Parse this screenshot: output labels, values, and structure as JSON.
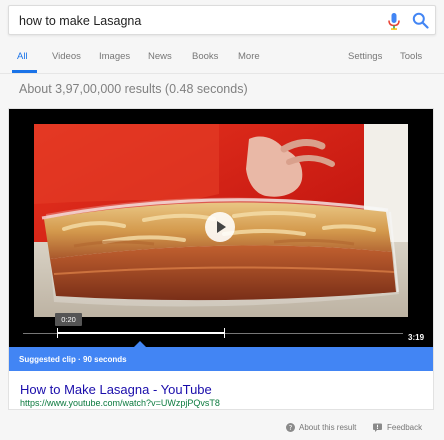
{
  "search": {
    "query": "how to make Lasagna",
    "mic_icon": "microphone-icon",
    "search_icon": "search-icon"
  },
  "tabs": [
    {
      "label": "All",
      "active": true
    },
    {
      "label": "Videos",
      "active": false
    },
    {
      "label": "Images",
      "active": false
    },
    {
      "label": "News",
      "active": false
    },
    {
      "label": "Books",
      "active": false
    },
    {
      "label": "More",
      "active": false
    },
    {
      "label": "Settings",
      "active": false
    },
    {
      "label": "Tools",
      "active": false
    }
  ],
  "result_stats": "About 3,97,00,000 results (0.48 seconds)",
  "video": {
    "clip_time": "0:20",
    "duration": "3:19",
    "suggested_clip": "Suggested clip · 90 seconds"
  },
  "result": {
    "title": "How to Make Lasagna - YouTube",
    "url": "https://www.youtube.com/watch?v=UWzpjPQvsT8"
  },
  "footer": {
    "about": "About this result",
    "feedback": "Feedback"
  },
  "colors": {
    "accent": "#4285f4",
    "link": "#1a0dab",
    "url": "#0b7a3e"
  }
}
